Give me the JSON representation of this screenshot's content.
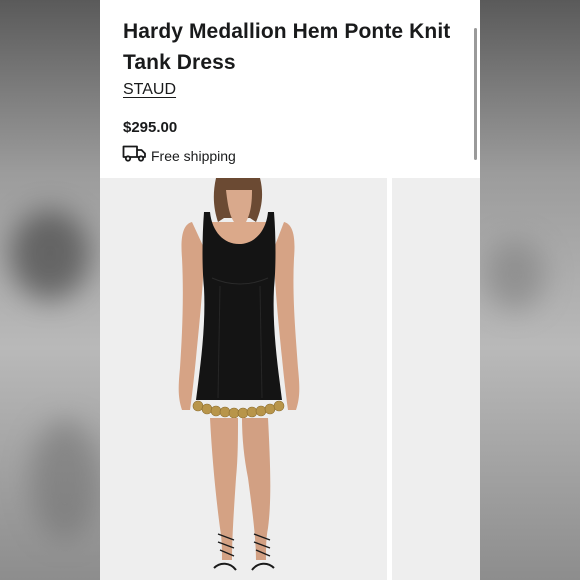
{
  "product": {
    "title": "Hardy Medallion Hem Ponte Knit Tank Dress",
    "brand": "STAUD",
    "price": "$295.00",
    "shipping": "Free shipping"
  },
  "icons": {
    "shipping": "truck-icon"
  },
  "colors": {
    "text": "#191a1b",
    "photo_background": "#eeeeee",
    "dress": "#141414",
    "medallion": "#b8954a"
  }
}
